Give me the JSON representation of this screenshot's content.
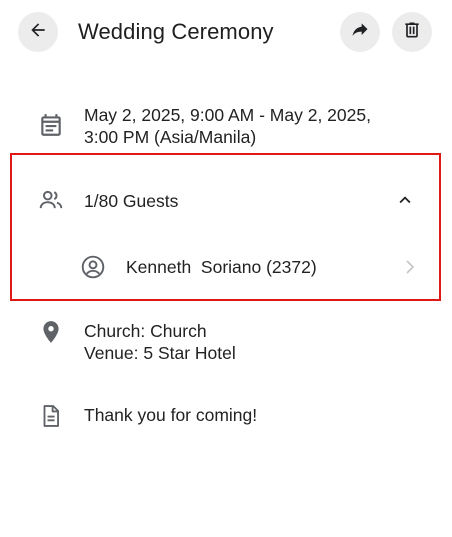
{
  "header": {
    "title": "Wedding Ceremony",
    "back_icon": "arrow-left-icon",
    "share_icon": "share-arrow-icon",
    "delete_icon": "trash-icon"
  },
  "schedule": {
    "icon": "calendar-icon",
    "line1": "May 2, 2025, 9:00 AM - May 2, 2025,",
    "line2": "3:00 PM (Asia/Manila)"
  },
  "guests": {
    "icon": "people-icon",
    "summary": "1/80 Guests",
    "expanded": true,
    "list": [
      {
        "name": "Kenneth  Soriano (2372)",
        "icon": "account-circle-icon"
      }
    ]
  },
  "location": {
    "icon": "map-pin-icon",
    "church": "Church: Church",
    "venue": "Venue: 5 Star Hotel"
  },
  "note": {
    "icon": "document-icon",
    "text": "Thank you for coming!"
  },
  "colors": {
    "highlight_border": "#e01818",
    "button_bg": "#ececec",
    "icon_gray": "#5f6368"
  }
}
